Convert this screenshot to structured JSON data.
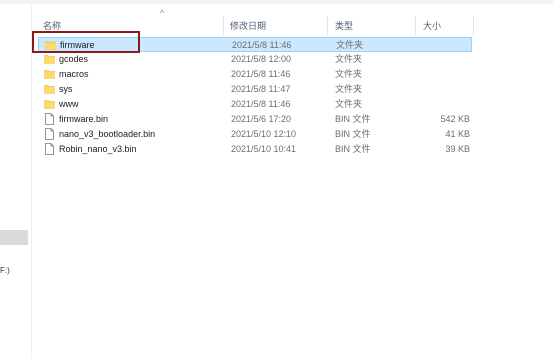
{
  "columns": {
    "name": "名称",
    "date": "修改日期",
    "type": "类型",
    "size": "大小"
  },
  "nav": {
    "drive_label": "F:)"
  },
  "files": [
    {
      "name": "firmware",
      "date": "2021/5/8 11:46",
      "type": "文件夹",
      "size": "",
      "kind": "folder",
      "selected": true
    },
    {
      "name": "gcodes",
      "date": "2021/5/8 12:00",
      "type": "文件夹",
      "size": "",
      "kind": "folder"
    },
    {
      "name": "macros",
      "date": "2021/5/8 11:46",
      "type": "文件夹",
      "size": "",
      "kind": "folder"
    },
    {
      "name": "sys",
      "date": "2021/5/8 11:47",
      "type": "文件夹",
      "size": "",
      "kind": "folder"
    },
    {
      "name": "www",
      "date": "2021/5/8 11:46",
      "type": "文件夹",
      "size": "",
      "kind": "folder"
    },
    {
      "name": "firmware.bin",
      "date": "2021/5/6 17:20",
      "type": "BIN 文件",
      "size": "542 KB",
      "kind": "file"
    },
    {
      "name": "nano_v3_bootloader.bin",
      "date": "2021/5/10 12:10",
      "type": "BIN 文件",
      "size": "41 KB",
      "kind": "file"
    },
    {
      "name": "Robin_nano_v3.bin",
      "date": "2021/5/10 10:41",
      "type": "BIN 文件",
      "size": "39 KB",
      "kind": "file"
    }
  ],
  "colors": {
    "selection": "#cce8ff",
    "highlight_box": "#8b1a1a",
    "folder": "#f8d775"
  }
}
